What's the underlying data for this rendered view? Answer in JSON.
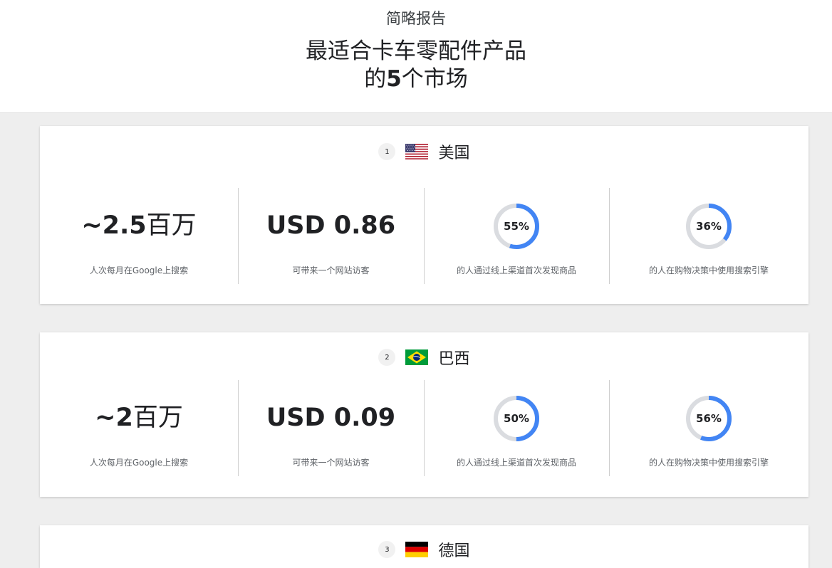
{
  "header": {
    "subtitle": "简略报告",
    "title_line1": "最适合卡车零配件产品",
    "title_line2_pre": "的",
    "title_line2_num": "5",
    "title_line2_post": "个市场"
  },
  "colors": {
    "accent": "#4285f4",
    "ring_track": "#dadce0",
    "page_bg": "#eeeeee"
  },
  "markets": [
    {
      "rank": "1",
      "country": "美国",
      "flag_icon": "us-flag-icon",
      "searches_num": "~2.5",
      "searches_unit": "百万",
      "searches_caption": "人次每月在Google上搜索",
      "cost": "USD 0.86",
      "cost_caption": "可带来一个网站访客",
      "discover_pct": 55,
      "discover_label": "55%",
      "discover_caption": "的人通过线上渠道首次发现商品",
      "search_engine_pct": 36,
      "search_engine_label": "36%",
      "search_engine_caption": "的人在购物决策中使用搜索引擎"
    },
    {
      "rank": "2",
      "country": "巴西",
      "flag_icon": "brazil-flag-icon",
      "searches_num": "~2",
      "searches_unit": "百万",
      "searches_caption": "人次每月在Google上搜索",
      "cost": "USD 0.09",
      "cost_caption": "可带来一个网站访客",
      "discover_pct": 50,
      "discover_label": "50%",
      "discover_caption": "的人通过线上渠道首次发现商品",
      "search_engine_pct": 56,
      "search_engine_label": "56%",
      "search_engine_caption": "的人在购物决策中使用搜索引擎"
    },
    {
      "rank": "3",
      "country": "德国",
      "flag_icon": "germany-flag-icon"
    }
  ]
}
